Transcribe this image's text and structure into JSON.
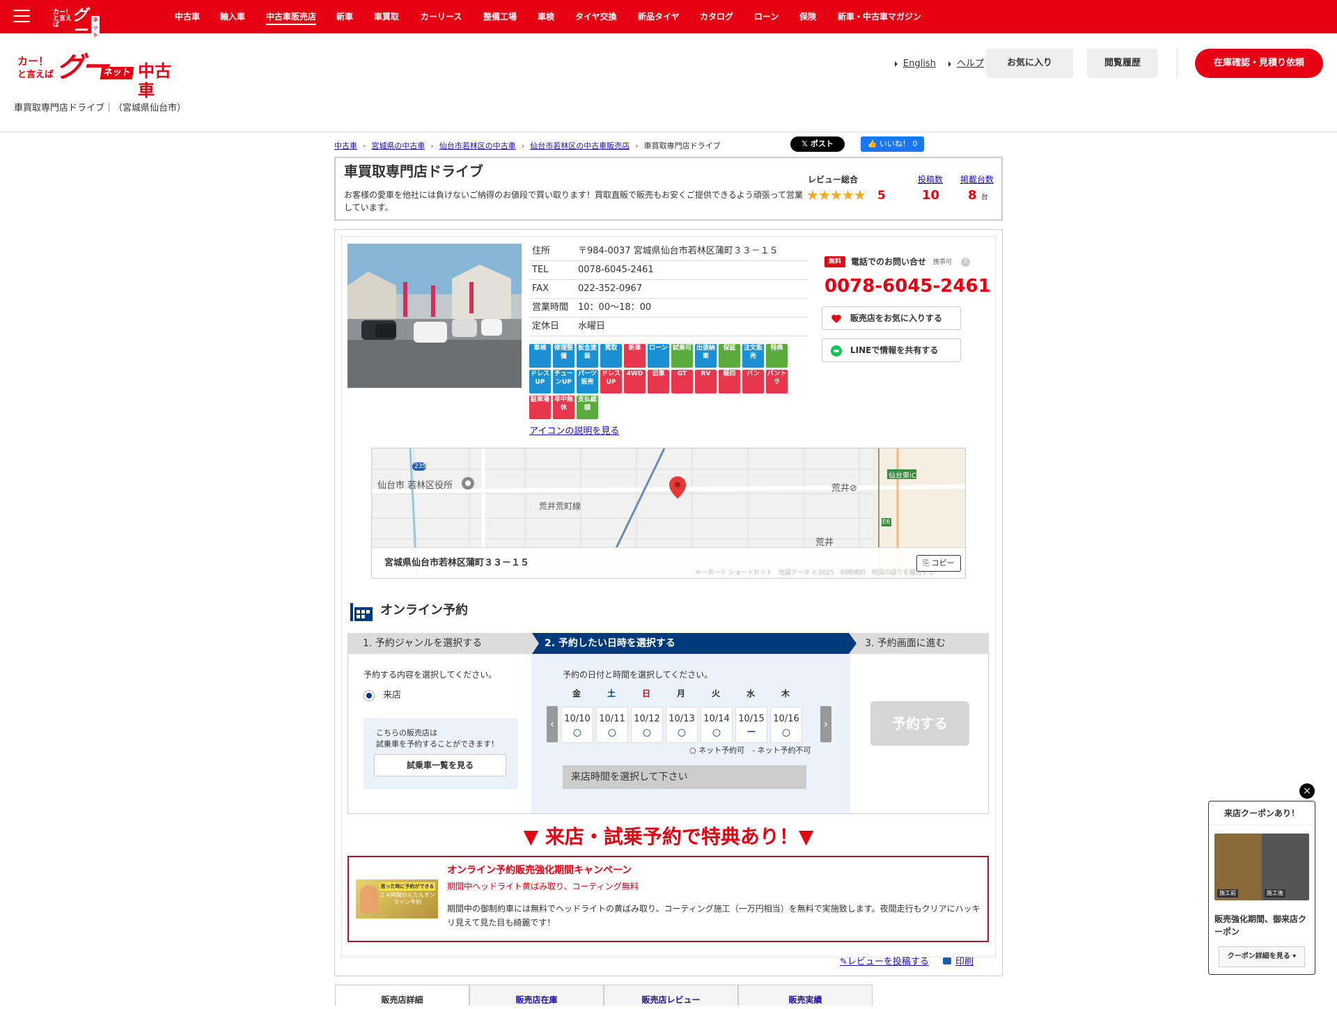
{
  "topnav": {
    "items": [
      "中古車",
      "輸入車",
      "中古車販売店",
      "新車",
      "車買取",
      "カーリース",
      "整備工場",
      "車検",
      "タイヤ交換",
      "新品タイヤ",
      "カタログ",
      "ローン",
      "保険",
      "新車・中古車マガジン"
    ],
    "active": "中古車販売店",
    "logo_small": "カー！と言えば",
    "logo_goo": "グー",
    "logo_net": "ネット"
  },
  "header": {
    "logo_car": "カー！",
    "logo_toieba": "と言えば",
    "logo_goo": "グー",
    "logo_net": "ネット",
    "logo_chukosha": "中古車",
    "english": "English",
    "help": "ヘルプ",
    "favorites": "お気に入り",
    "history": "閲覧履歴",
    "inquiry": "在庫確認・見積り依頼"
  },
  "subheader": "車買取専門店ドライブ｜（宮城県仙台市）",
  "breadcrumb": [
    "中古車",
    "宮城県の中古車",
    "仙台市若林区の中古車",
    "仙台市若林区の中古車販売店",
    "車買取専門店ドライブ"
  ],
  "social": {
    "x": "𝕏 ポスト",
    "fb": "👍 いいね！ 0"
  },
  "shop": {
    "name": "車買取専門店ドライブ",
    "desc": "お客様の愛車を他社には負けないご納得のお値段で買い取ります！買取直販で販売もお安くご提供できるよう頑張って営業しています。",
    "review_label": "レビュー総合",
    "stars": "★★★★★",
    "review_score": "5",
    "posts_label": "投稿数",
    "posts": "10",
    "listing_label": "掲載台数",
    "listing": "8",
    "listing_unit": "台"
  },
  "info": [
    {
      "k": "住所",
      "v": "〒984-0037 宮城県仙台市若林区蒲町３３－１５"
    },
    {
      "k": "TEL",
      "v": "0078-6045-2461"
    },
    {
      "k": "FAX",
      "v": "022-352-0967"
    },
    {
      "k": "営業時間",
      "v": "10：00〜18：00"
    },
    {
      "k": "定休日",
      "v": "水曜日"
    }
  ],
  "icons": [
    {
      "t": "車検",
      "c": "#1a8fd1"
    },
    {
      "t": "修理整備",
      "c": "#1a8fd1"
    },
    {
      "t": "板金塗装",
      "c": "#1a8fd1"
    },
    {
      "t": "買取",
      "c": "#1a8fd1"
    },
    {
      "t": "新車",
      "c": "#e8374d"
    },
    {
      "t": "ローン",
      "c": "#1a8fd1"
    },
    {
      "t": "試乗可",
      "c": "#5aaa3c"
    },
    {
      "t": "出張納車",
      "c": "#1a8fd1"
    },
    {
      "t": "保証",
      "c": "#5aaa3c"
    },
    {
      "t": "注文販売",
      "c": "#1a8fd1"
    },
    {
      "t": "特典",
      "c": "#5aaa3c"
    },
    {
      "t": "ドレスUP",
      "c": "#1a8fd1"
    },
    {
      "t": "チューンUP",
      "c": "#1a8fd1"
    },
    {
      "t": "パーツ販売",
      "c": "#1a8fd1"
    },
    {
      "t": "ドレスUP",
      "c": "#e8374d"
    },
    {
      "t": "4WD",
      "c": "#e8374d"
    },
    {
      "t": "旧車",
      "c": "#e8374d"
    },
    {
      "t": "GT",
      "c": "#e8374d"
    },
    {
      "t": "RV",
      "c": "#e8374d"
    },
    {
      "t": "軽四",
      "c": "#e8374d"
    },
    {
      "t": "バン",
      "c": "#e8374d"
    },
    {
      "t": "バントラ",
      "c": "#e8374d"
    },
    {
      "t": "駐車場",
      "c": "#e8374d"
    },
    {
      "t": "年中無休",
      "c": "#e8374d"
    },
    {
      "t": "支払総額",
      "c": "#5aaa3c"
    }
  ],
  "icon_link": "アイコンの説明を見る",
  "tel": {
    "free": "無料",
    "label": "電話でのお問い合せ",
    "mobile": "携帯可",
    "q": "?",
    "number": "0078-6045-2461",
    "fav": "販売店をお気に入りする",
    "line": "LINEで情報を共有する"
  },
  "map": {
    "address": "宮城県仙台市若林区蒲町３３－１５",
    "copy": "コピー",
    "labels": [
      "仙台市 若林区役所",
      "荒井荒町線",
      "荒井⊘",
      "荒井",
      "仙台東IC",
      "235",
      "E6"
    ],
    "footer": "キーボード ショートカット　地図データ ©2025　利用規約　地図の誤りを報告する"
  },
  "online": {
    "title": "オンライン予約",
    "steps": [
      "1. 予約ジャンルを選択する",
      "2. 予約したい日時を選択する",
      "3. 予約画面に進む"
    ],
    "col1_prompt": "予約する内容を選択してください。",
    "radio": "来店",
    "test_note1": "こちらの販売店は",
    "test_note2": "試乗車を予約することができます！",
    "test_btn": "試乗車一覧を見る",
    "col2_prompt": "予約の日付と時間を選択してください。",
    "days": [
      {
        "d": "金",
        "c": "#333"
      },
      {
        "d": "土",
        "c": "#003a7d"
      },
      {
        "d": "日",
        "c": "#e60012"
      },
      {
        "d": "月",
        "c": "#333"
      },
      {
        "d": "火",
        "c": "#333"
      },
      {
        "d": "水",
        "c": "#333"
      },
      {
        "d": "木",
        "c": "#333"
      }
    ],
    "dates": [
      {
        "d": "10/10",
        "m": "○"
      },
      {
        "d": "10/11",
        "m": "○"
      },
      {
        "d": "10/12",
        "m": "○"
      },
      {
        "d": "10/13",
        "m": "○"
      },
      {
        "d": "10/14",
        "m": "○"
      },
      {
        "d": "10/15",
        "m": "－"
      },
      {
        "d": "10/16",
        "m": "○"
      }
    ],
    "legend": "○ ネット予約可　- ネット予約不可",
    "time_select": "来店時間を選択して下さい",
    "reserve": "予約する"
  },
  "promo": "▼ 来店・試乗予約で特典あり！▼",
  "campaign": {
    "title": "オンライン予約販売強化期間キャンペーン",
    "sub": "期間中ヘッドライト黄ばみ取り、コーティング無料",
    "body": "期間中の御制約車には無料でヘッドライトの黄ばみ取り、コーティング施工（一万円相当）を無料で実施致します。夜間走行もクリアにハッキリ見えて見た目も綺麗です！",
    "img_t1": "思った時に予約ができる",
    "img_t2": "２４時間かんたんオンライン予約"
  },
  "links": {
    "review": "レビューを投稿する",
    "print": "印刷"
  },
  "tabs": [
    "販売店詳細",
    "販売店在庫",
    "販売店レビュー",
    "販売実績"
  ],
  "coupon": {
    "close": "×",
    "title": "来店クーポンあり！",
    "before": "施工前",
    "after": "施工後",
    "text": "販売強化期間、御来店クーポン",
    "btn": "クーポン詳細を見る ▾"
  }
}
